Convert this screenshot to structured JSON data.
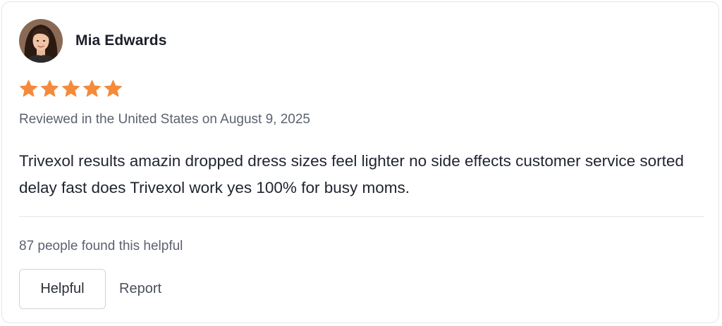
{
  "review": {
    "reviewer_name": "Mia Edwards",
    "rating": 5,
    "rating_max": 5,
    "star_color": "#f58a3a",
    "meta": "Reviewed in the United States on August 9, 2025",
    "body": "Trivexol results amazin dropped dress sizes feel lighter no side effects customer service sorted delay fast does Trivexol work yes 100% for busy moms."
  },
  "footer": {
    "helpful_count_text": "87 people found this helpful",
    "helpful_label": "Helpful",
    "report_label": "Report"
  },
  "icons": {
    "avatar": "avatar-photo",
    "star": "star-icon"
  }
}
